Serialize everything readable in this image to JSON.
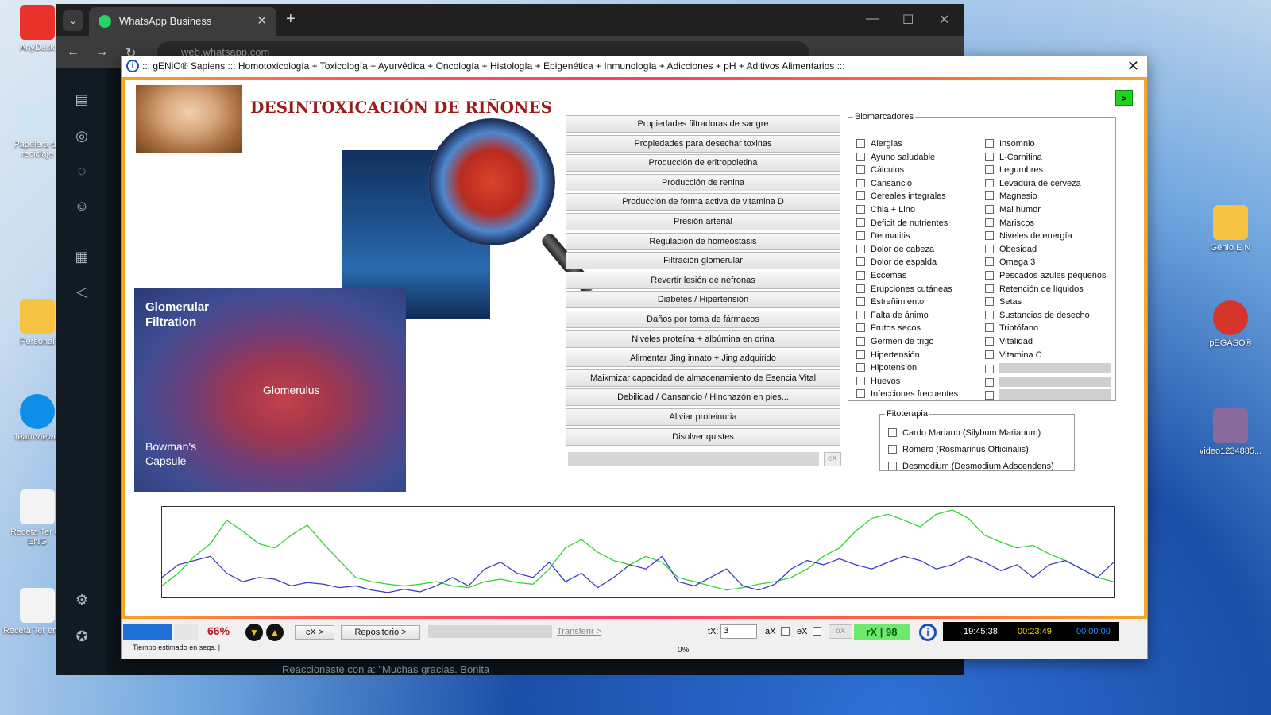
{
  "desktop": {
    "icons": [
      {
        "label": "AnyDesk"
      },
      {
        "label": "Papelera de reciclaje"
      },
      {
        "label": "Personal"
      },
      {
        "label": "TeamViewer"
      },
      {
        "label": "Receta Ter en ENG"
      },
      {
        "label": "Receta Ter en ES"
      },
      {
        "label": "Genio E N"
      },
      {
        "label": "pEGASO®"
      },
      {
        "label": "video1234885..."
      }
    ]
  },
  "browser": {
    "tab_title": "WhatsApp Business",
    "url": "web.whatsapp.com",
    "wa_preview": "Reaccionaste con",
    "wa_preview_msg": "a: \"Muchas gracias. Bonita"
  },
  "app": {
    "window_title": "::: gENiO® Sapiens ::: Homotoxicología + Toxicología + Ayurvédica + Oncología + Histología + Epigenética + Inmunología + Adicciones + pH + Aditivos Alimentarios :::",
    "heading": "DESINTOXICACIÓN DE RIÑONES",
    "next_button": ">",
    "image_labels": {
      "glomerular": "Glomerular Filtration",
      "glomerulus": "Glomerulus",
      "bowman": "Bowman's Capsule"
    },
    "buttons": [
      "Propiedades filtradoras de sangre",
      "Propiedades para desechar toxinas",
      "Producción de eritropoietina",
      "Producción de renina",
      "Producción de forma activa de vitamina D",
      "Presión arterial",
      "Regulación de homeostasis",
      "Filtración glomerular",
      "Revertir lesión de nefronas",
      "Diabetes / Hipertensión",
      "Daños por toma de fármacos",
      "Niveles proteína + albúmina en orina",
      "Alimentar Jing innato + Jing adquirido",
      "Maixmizar capacidad de almacenamiento de Esencia Vital",
      "Debilidad / Cansancio / Hinchazón en pies...",
      "Aliviar proteinuria",
      "Disolver quistes"
    ],
    "ex_button": "eX",
    "biomarcadores": {
      "legend": "Biomarcadores",
      "col1": [
        "Alergias",
        "Ayuno saludable",
        "Cálculos",
        "Cansancio",
        "Cereales integrales",
        "Chia + Lino",
        "Deficit de nutrientes",
        "Dermatitis",
        "Dolor de cabeza",
        "Dolor de espalda",
        "Eccemas",
        "Erupciones cutáneas",
        "Estreñimiento",
        "Falta de ánimo",
        "Frutos secos",
        "Germen de trigo",
        "Hipertensión",
        "Hipotensión",
        "Huevos",
        "Infecciones frecuentes"
      ],
      "col2": [
        "Insomnio",
        "L-Carnitina",
        "Legumbres",
        "Levadura de cerveza",
        "Magnesio",
        "Mal humor",
        "Mariscos",
        "Niveles de energía",
        "Obesidad",
        "Omega 3",
        "Pescados azules pequeños",
        "Retención de líquidos",
        "Setas",
        "Sustancias de desecho",
        "Triptófano",
        "Vitalidad",
        "Vitamina C"
      ]
    },
    "fitoterapia": {
      "legend": "Fitoterapia",
      "items": [
        "Cardo Mariano (Silybum Marianum)",
        "Romero (Rosmarinus Officinalis)",
        "Desmodium (Desmodium Adscendens)"
      ]
    },
    "status": {
      "progress_pct": "66%",
      "progress_value": 0.66,
      "tiempo": "Tiempo estimado en segs. |",
      "cx_button": "cX >",
      "repositorio_button": "Repositorio >",
      "transferir": "Transferir >",
      "zero_pct": "0%",
      "tx_label": "tX:",
      "tx_value": "3",
      "ax_label": "aX",
      "ex_label": "eX",
      "bx_button": "bX",
      "rx_display": "rX | 98",
      "time1": "19:45:38",
      "time2": "00:23:49",
      "time3": "00:00:00",
      "colors": {
        "time1": "#ffffff",
        "time2": "#f5d400",
        "time3": "#2b8cff"
      }
    }
  },
  "chart_data": {
    "type": "line",
    "title": "",
    "xlabel": "",
    "ylabel": "",
    "x_count": 60,
    "ylim": [
      0,
      100
    ],
    "series": [
      {
        "color": "#32d232",
        "values": [
          10,
          25,
          45,
          60,
          88,
          75,
          60,
          55,
          70,
          82,
          60,
          40,
          20,
          15,
          12,
          10,
          12,
          15,
          10,
          8,
          15,
          18,
          14,
          12,
          30,
          55,
          65,
          50,
          40,
          35,
          45,
          38,
          20,
          15,
          10,
          5,
          8,
          12,
          15,
          20,
          30,
          45,
          55,
          75,
          90,
          95,
          88,
          80,
          95,
          100,
          90,
          70,
          62,
          55,
          58,
          48,
          40,
          30,
          20,
          15
        ]
      },
      {
        "color": "#3a3acb",
        "values": [
          20,
          35,
          40,
          45,
          25,
          15,
          20,
          18,
          10,
          14,
          12,
          8,
          10,
          5,
          2,
          6,
          3,
          10,
          20,
          10,
          30,
          38,
          25,
          20,
          38,
          15,
          25,
          8,
          20,
          35,
          30,
          45,
          15,
          10,
          20,
          30,
          10,
          5,
          12,
          30,
          40,
          35,
          42,
          35,
          30,
          38,
          45,
          40,
          30,
          35,
          45,
          38,
          28,
          35,
          20,
          35,
          40,
          30,
          20,
          38
        ]
      }
    ]
  }
}
